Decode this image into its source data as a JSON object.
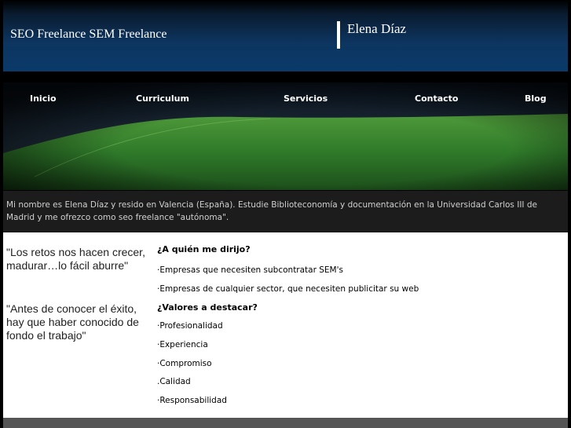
{
  "header": {
    "site_title": "SEO Freelance SEM Freelance",
    "name": "Elena Díaz"
  },
  "nav": {
    "items": [
      {
        "label": "Inicio"
      },
      {
        "label": "Curriculum"
      },
      {
        "label": "Servicios"
      },
      {
        "label": "Contacto"
      },
      {
        "label": "Blog"
      }
    ]
  },
  "intro": {
    "text": "Mi nombre es Elena Díaz y resido en Valencia (España). Estudie Biblioteconomía y documentación en la Universidad Carlos III de Madrid y me ofrezco como seo freelance \"autónoma\"."
  },
  "quotes": [
    "\"Los retos nos hacen crecer, madurar…lo fácil aburre\"",
    "\"Antes de conocer el éxito, hay que haber conocido de fondo el trabajo\""
  ],
  "sections": {
    "target": {
      "heading": "¿A quién me dirijo?",
      "items": [
        "·Empresas que necesiten subcontratar SEM's",
        "·Empresas de cualquier sector, que necesiten publicitar su web"
      ]
    },
    "values": {
      "heading": "¿Valores a destacar?",
      "items": [
        "·Profesionalidad",
        "·Experiencia",
        "·Compromiso",
        ".Calidad",
        "·Responsabilidad"
      ]
    }
  },
  "colors": {
    "header_blue": "#0d3560",
    "grass_green": "#2f7a2a",
    "intro_bg": "#1c1c1c"
  }
}
